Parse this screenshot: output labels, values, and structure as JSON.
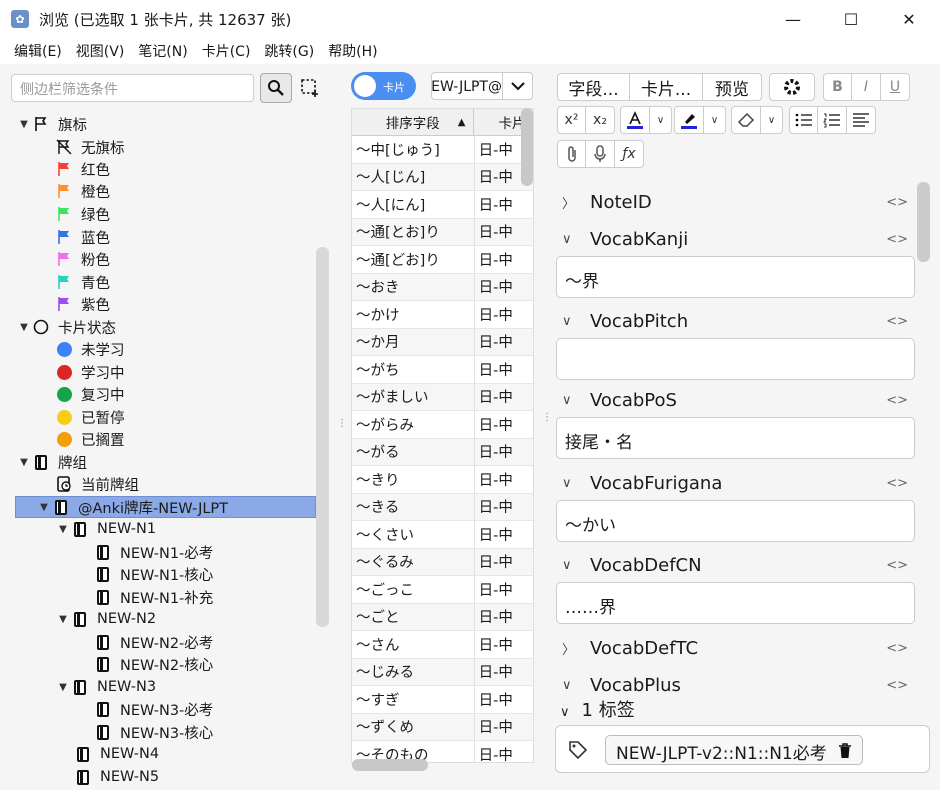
{
  "window": {
    "title": "浏览 (已选取 1 张卡片, 共 12637 张)",
    "minimize": "—",
    "maximize": "☐",
    "close": "✕"
  },
  "menu": [
    "编辑(E)",
    "视图(V)",
    "笔记(N)",
    "卡片(C)",
    "跳转(G)",
    "帮助(H)"
  ],
  "sidebar": {
    "search_placeholder": "侧边栏筛选条件",
    "flags": {
      "label": "旗标",
      "items": [
        {
          "label": "无旗标",
          "color": "#111111"
        },
        {
          "label": "红色",
          "color": "#f44336"
        },
        {
          "label": "橙色",
          "color": "#ff9130"
        },
        {
          "label": "绿色",
          "color": "#3ee45f"
        },
        {
          "label": "蓝色",
          "color": "#3375e8"
        },
        {
          "label": "粉色",
          "color": "#ef6fe9"
        },
        {
          "label": "青色",
          "color": "#25d3c2"
        },
        {
          "label": "紫色",
          "color": "#9c4ef0"
        }
      ]
    },
    "card_state": {
      "label": "卡片状态",
      "items": [
        {
          "label": "未学习",
          "color": "#3b82f6"
        },
        {
          "label": "学习中",
          "color": "#dc2626"
        },
        {
          "label": "复习中",
          "color": "#16a34a"
        },
        {
          "label": "已暂停",
          "color": "#facc15"
        },
        {
          "label": "已搁置",
          "color": "#f59e0b"
        }
      ]
    },
    "decks": {
      "label": "牌组",
      "current": "当前牌组",
      "root": "@Anki牌库-NEW-JLPT",
      "n1": "NEW-N1",
      "n1_children": [
        "NEW-N1-必考",
        "NEW-N1-核心",
        "NEW-N1-补充"
      ],
      "n2": "NEW-N2",
      "n2_children": [
        "NEW-N2-必考",
        "NEW-N2-核心"
      ],
      "n3": "NEW-N3",
      "n3_children": [
        "NEW-N3-必考",
        "NEW-N3-核心"
      ],
      "n4": "NEW-N4",
      "n5": "NEW-N5"
    }
  },
  "browser": {
    "toggle_label": "卡片",
    "deck_combo": "@Anki牌库-NEW-JLPT",
    "col_sort": "排序字段",
    "col_card": "卡片",
    "rows": [
      [
        "～中[じゅう]",
        "日-中"
      ],
      [
        "～人[じん]",
        "日-中"
      ],
      [
        "～人[にん]",
        "日-中"
      ],
      [
        "～通[とお]り",
        "日-中"
      ],
      [
        "～通[どお]り",
        "日-中"
      ],
      [
        "～おき",
        "日-中"
      ],
      [
        "～かけ",
        "日-中"
      ],
      [
        "～か月",
        "日-中"
      ],
      [
        "～がち",
        "日-中"
      ],
      [
        "～がましい",
        "日-中"
      ],
      [
        "～がらみ",
        "日-中"
      ],
      [
        "～がる",
        "日-中"
      ],
      [
        "～きり",
        "日-中"
      ],
      [
        "～きる",
        "日-中"
      ],
      [
        "～くさい",
        "日-中"
      ],
      [
        "～ぐるみ",
        "日-中"
      ],
      [
        "～ごっこ",
        "日-中"
      ],
      [
        "～ごと",
        "日-中"
      ],
      [
        "～さん",
        "日-中"
      ],
      [
        "～じみる",
        "日-中"
      ],
      [
        "～すぎ",
        "日-中"
      ],
      [
        "～ずくめ",
        "日-中"
      ],
      [
        "～そのもの",
        "日-中"
      ]
    ]
  },
  "editor": {
    "fields_btn": "字段...",
    "cards_btn": "卡片...",
    "preview_btn": "预览",
    "fields": [
      {
        "name": "NoteID",
        "value": "",
        "collapsed": true
      },
      {
        "name": "VocabKanji",
        "value": "～界"
      },
      {
        "name": "VocabPitch",
        "value": ""
      },
      {
        "name": "VocabPoS",
        "value": "接尾・名"
      },
      {
        "name": "VocabFurigana",
        "value": "～かい"
      },
      {
        "name": "VocabDefCN",
        "value": "……界"
      },
      {
        "name": "VocabDefTC",
        "value": "",
        "collapsed": true
      },
      {
        "name": "VocabPlus",
        "value": ""
      }
    ],
    "tags_header": "1 标签",
    "tag": "NEW-JLPT-v2::N1::N1必考"
  }
}
